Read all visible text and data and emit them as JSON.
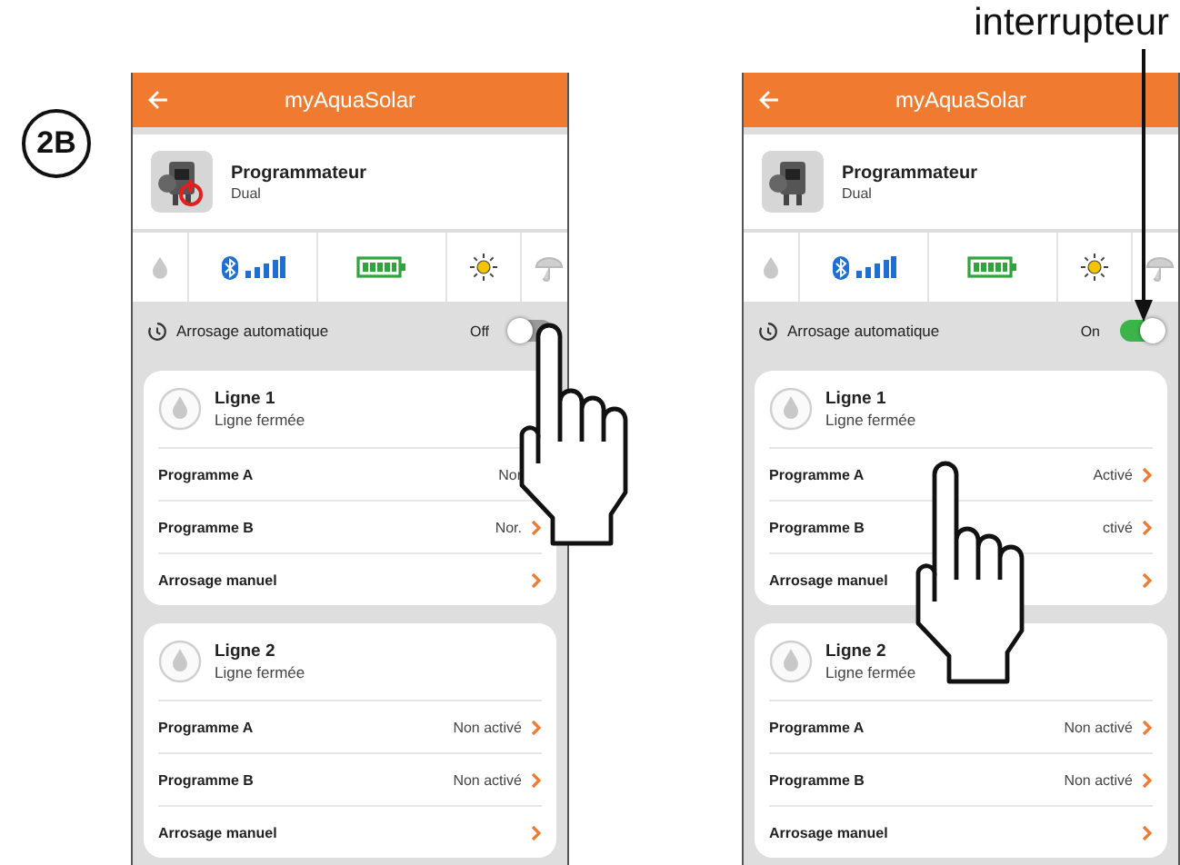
{
  "step_label": "2B",
  "callout": {
    "text": "interrupteur"
  },
  "phones": [
    {
      "title": "myAquaSolar",
      "device": {
        "name": "Programmateur",
        "model": "Dual",
        "power_alert": true
      },
      "auto": {
        "label": "Arrosage automatique",
        "state_text": "Off",
        "on": false,
        "pointed": true
      },
      "lines": [
        {
          "name": "Ligne 1",
          "status": "Ligne fermée",
          "rows": [
            {
              "label": "Programme A",
              "value": "Nor"
            },
            {
              "label": "Programme B",
              "value": "Nor."
            },
            {
              "label": "Arrosage manuel"
            }
          ]
        },
        {
          "name": "Ligne 2",
          "status": "Ligne fermée",
          "rows": [
            {
              "label": "Programme A",
              "value": "Non activé"
            },
            {
              "label": "Programme B",
              "value": "Non activé"
            },
            {
              "label": "Arrosage manuel"
            }
          ]
        }
      ]
    },
    {
      "title": "myAquaSolar",
      "device": {
        "name": "Programmateur",
        "model": "Dual",
        "power_alert": false
      },
      "auto": {
        "label": "Arrosage automatique",
        "state_text": "On",
        "on": true,
        "pointed": false
      },
      "lines": [
        {
          "name": "Ligne 1",
          "status": "Ligne fermée",
          "rows": [
            {
              "label": "Programme A",
              "value": "Activé",
              "pointed": true
            },
            {
              "label": "Programme B",
              "value": "ctivé"
            },
            {
              "label": "Arrosage manuel"
            }
          ]
        },
        {
          "name": "Ligne 2",
          "status": "Ligne fermée",
          "rows": [
            {
              "label": "Programme A",
              "value": "Non activé"
            },
            {
              "label": "Programme B",
              "value": "Non activé"
            },
            {
              "label": "Arrosage manuel"
            }
          ]
        }
      ]
    }
  ]
}
